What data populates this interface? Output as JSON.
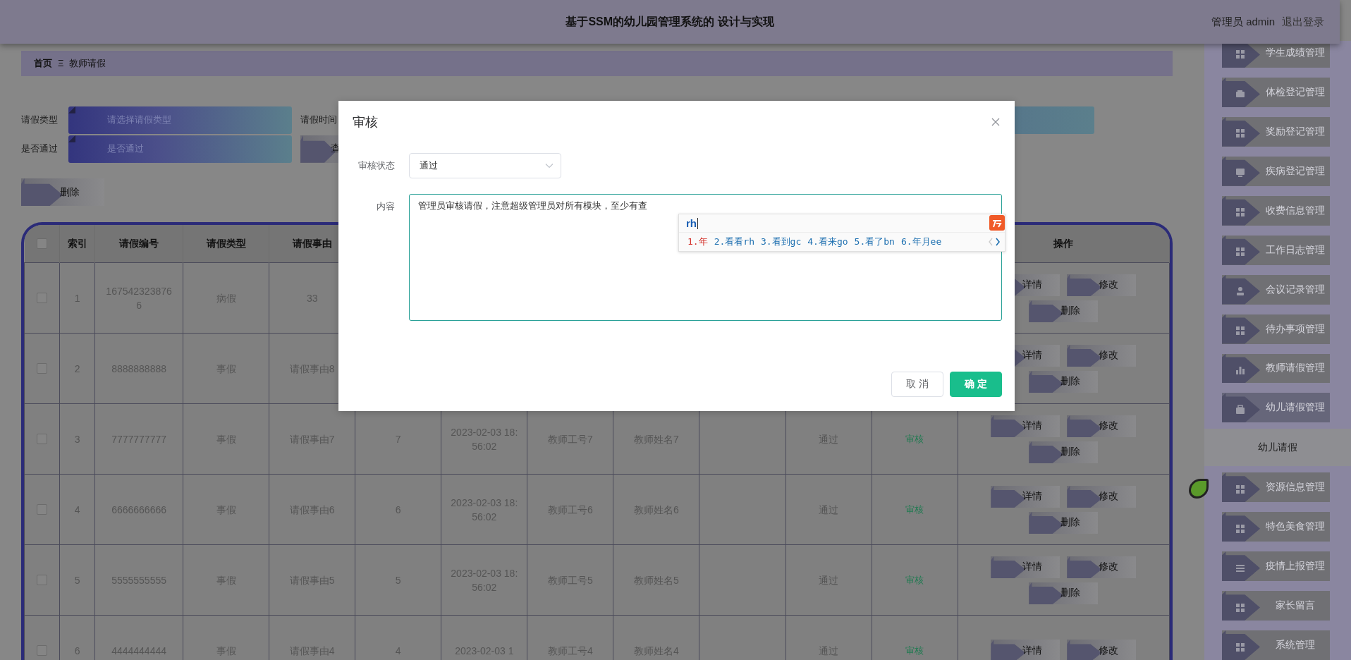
{
  "header": {
    "title": "基于SSM的幼儿园管理系统的 设计与实现",
    "user": "管理员 admin",
    "logout": "退出登录"
  },
  "breadcrumb": {
    "home": "首页",
    "separator": "Ξ",
    "current": "教师请假"
  },
  "filters": [
    {
      "label": "请假类型",
      "placeholder": "请选择请假类型"
    },
    {
      "label": "是否通过",
      "placeholder": "是否通过"
    }
  ],
  "date_filter": {
    "label": "请假时间"
  },
  "search_button": "查",
  "delete_button": "删除",
  "table": {
    "select_all": {
      "checked": false
    },
    "columns": [
      "索引",
      "请假编号",
      "请假类型",
      "请假事由",
      null,
      null,
      null,
      null,
      null,
      null,
      null,
      "操作"
    ],
    "rows": [
      {
        "checked": false,
        "cells": [
          "1",
          "1675423238766",
          "病假",
          "33"
        ],
        "actions": [
          "详情",
          "修改",
          "删除"
        ]
      },
      {
        "checked": false,
        "cells": [
          "2",
          "8888888888",
          "事假",
          "请假事由8"
        ],
        "actions": [
          "详情",
          "修改",
          "删除"
        ]
      },
      {
        "checked": false,
        "cells": [
          "3",
          "7777777777",
          "事假",
          "请假事由7",
          "7",
          "2023-02-03 18:56:02",
          "教师工号7",
          "教师姓名7",
          null,
          "通过"
        ],
        "review_link": "审核",
        "actions": [
          "详情",
          "修改",
          "删除"
        ]
      },
      {
        "checked": false,
        "cells": [
          "4",
          "6666666666",
          "事假",
          "请假事由6",
          "6",
          "2023-02-03 18:56:02",
          "教师工号6",
          "教师姓名6",
          null,
          "通过"
        ],
        "review_link": "审核",
        "actions": [
          "详情",
          "修改",
          "删除"
        ]
      },
      {
        "checked": false,
        "cells": [
          "5",
          "5555555555",
          "事假",
          "请假事由5",
          "5",
          "2023-02-03 18:56:02",
          "教师工号5",
          "教师姓名5",
          null,
          "通过"
        ],
        "review_link": "审核",
        "actions": [
          "详情",
          "修改",
          "删除"
        ]
      },
      {
        "checked": false,
        "cells": [
          "6",
          "4444444444",
          "事假",
          "请假事由4",
          "4",
          "2023-02-03 1",
          "教师工号4",
          "教师姓名4",
          null,
          "通过"
        ],
        "review_link": "审核",
        "actions": [
          "详情",
          "修改"
        ]
      }
    ]
  },
  "sidebar": {
    "items": [
      {
        "label": "学生成绩管理",
        "expanded": false
      },
      {
        "label": "体检登记管理",
        "expanded": false
      },
      {
        "label": "奖励登记管理",
        "expanded": false
      },
      {
        "label": "疾病登记管理",
        "expanded": false
      },
      {
        "label": "收费信息管理",
        "expanded": false
      },
      {
        "label": "工作日志管理",
        "expanded": false
      },
      {
        "label": "会议记录管理",
        "expanded": false
      },
      {
        "label": "待办事项管理",
        "expanded": false
      },
      {
        "label": "教师请假管理",
        "expanded": false
      },
      {
        "label": "幼儿请假管理",
        "expanded": true,
        "children": [
          {
            "label": "幼儿请假",
            "selected": false
          }
        ]
      },
      {
        "label": "资源信息管理",
        "expanded": false
      },
      {
        "label": "特色美食管理",
        "expanded": false
      },
      {
        "label": "疫情上报管理",
        "expanded": false
      },
      {
        "label": "家长留言",
        "expanded": false
      },
      {
        "label": "系统管理",
        "expanded": false
      }
    ]
  },
  "dialog": {
    "title": "审核",
    "status_label": "审核状态",
    "status_value": "通过",
    "content_label": "内容",
    "content_value": "管理员审核请假，注意超级管理员对所有模块，至少有查",
    "ime": {
      "composition": "rh",
      "candidates": [
        {
          "text": "1.年",
          "selected": true
        },
        {
          "text": "2.看看rh",
          "selected": false
        },
        {
          "text": "3.看到gc",
          "selected": false
        },
        {
          "text": "4.看来go",
          "selected": false
        },
        {
          "text": "5.看了bn",
          "selected": false
        },
        {
          "text": "6.年月ee",
          "selected": false
        }
      ]
    },
    "cancel": "取 消",
    "confirm": "确 定"
  }
}
